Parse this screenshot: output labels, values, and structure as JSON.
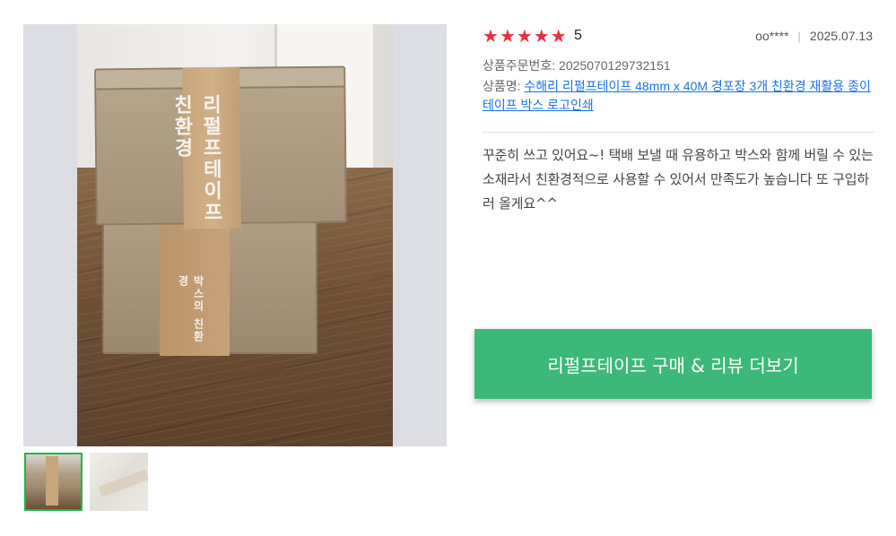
{
  "review": {
    "rating": 5,
    "score_text": "5",
    "stars": [
      "★",
      "★",
      "★",
      "★",
      "★"
    ],
    "star_color": "#e8303a",
    "author": "oo****",
    "date": "2025.07.13",
    "order_label": "상품주문번호: 2025070129732151",
    "product_label": "상품명: ",
    "product_name": "수해리 리펄프테이프 48mm x 40M 경포장 3개 친환경 재활용 종이테이프 박스 로고인쇄",
    "body": "꾸준히 쓰고 있어요~! 택배 보낼 때 유용하고 박스와 함께 버릴 수 있는 소재라서 친환경적으로 사용할 수 있어서 만족도가 높습니다 또 구입하러 올게요^^"
  },
  "photo": {
    "tape_text_top": "리펄프테이프 친환경",
    "tape_text_bottom": "박스의 친환경"
  },
  "thumbnails": [
    {
      "name": "thumbnail-1",
      "selected": true
    },
    {
      "name": "thumbnail-2",
      "selected": false
    }
  ],
  "cta": {
    "label": "리펄프테이프 구매 & 리뷰 더보기",
    "color": "#3cb978"
  },
  "colors": {
    "accent": "#3cb978",
    "star": "#e8303a",
    "link": "#1a73e8",
    "thumb_selected_border": "#1bb84a"
  }
}
